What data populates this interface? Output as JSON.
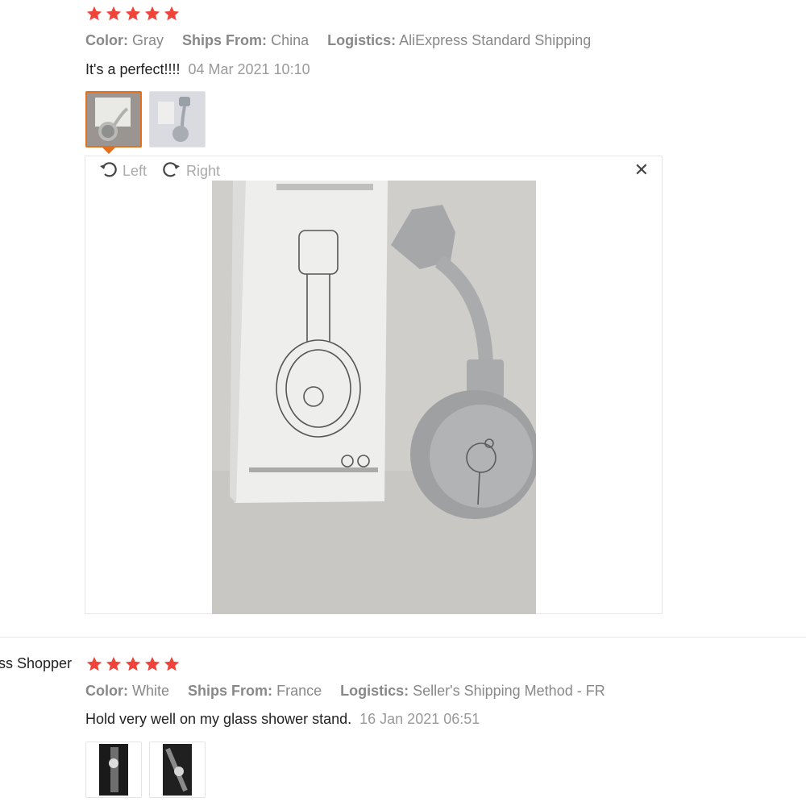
{
  "review1": {
    "rating": 5,
    "meta": {
      "color_label": "Color:",
      "color_value": "Gray",
      "ships_label": "Ships From:",
      "ships_value": "China",
      "logistics_label": "Logistics:",
      "logistics_value": "AliExpress Standard Shipping"
    },
    "comment": "It's a perfect!!!!",
    "date": "04 Mar 2021 10:10",
    "viewer": {
      "rotate_left_label": "Left",
      "rotate_right_label": "Right",
      "close_symbol": "✕"
    }
  },
  "review2": {
    "username": "ss Shopper",
    "rating": 5,
    "meta": {
      "color_label": "Color:",
      "color_value": "White",
      "ships_label": "Ships From:",
      "ships_value": "France",
      "logistics_label": "Logistics:",
      "logistics_value": "Seller's Shipping Method - FR"
    },
    "comment": "Hold very well on my glass shower stand.",
    "date": "16 Jan 2021 06:51"
  },
  "colors": {
    "star": "#f0443a",
    "accent": "#e2701d"
  },
  "icons": [
    "star-icon",
    "rotate-left-icon",
    "rotate-right-icon",
    "close-icon"
  ]
}
